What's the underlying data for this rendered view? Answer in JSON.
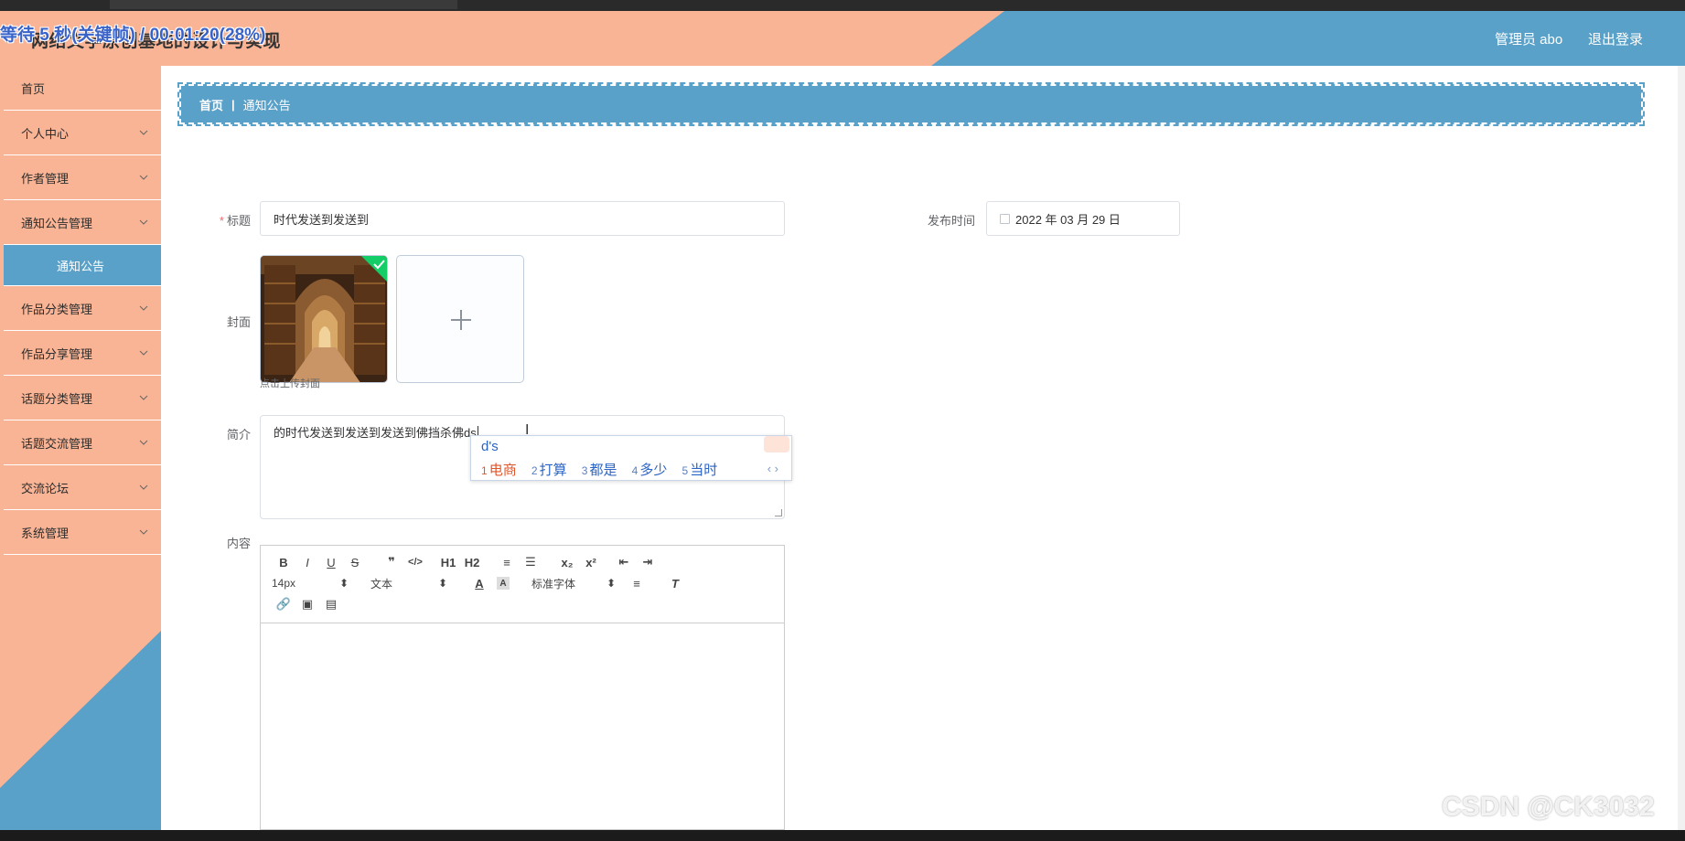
{
  "overlay_caption": "等待 5 秒(关键帧) / 00:01:20(28%)",
  "header": {
    "title": "网络文学原创基地的设计与实现",
    "admin_label": "管理员 abo",
    "logout_label": "退出登录"
  },
  "sidebar": {
    "items": [
      {
        "label": "首页",
        "chevron": false
      },
      {
        "label": "个人中心",
        "chevron": true
      },
      {
        "label": "作者管理",
        "chevron": true
      },
      {
        "label": "通知公告管理",
        "chevron": true
      },
      {
        "label": "作品分类管理",
        "chevron": true
      },
      {
        "label": "作品分享管理",
        "chevron": true
      },
      {
        "label": "话题分类管理",
        "chevron": true
      },
      {
        "label": "话题交流管理",
        "chevron": true
      },
      {
        "label": "交流论坛",
        "chevron": true
      },
      {
        "label": "系统管理",
        "chevron": true
      }
    ],
    "active_sub": "通知公告"
  },
  "breadcrumb": {
    "home": "首页",
    "separator": "|",
    "current": "通知公告"
  },
  "form": {
    "title_label": "标题",
    "title_value": "时代发送到发送到",
    "publish_time_label": "发布时间",
    "publish_time_value": "2022 年 03 月 29 日",
    "cover_label": "封面",
    "cover_hint": "点击上传封面",
    "intro_label": "简介",
    "intro_value": "的时代发送到发送到发送到佛挡杀佛ds",
    "content_label": "内容"
  },
  "ime": {
    "composition": "d's",
    "candidates": [
      {
        "num": "1",
        "text": "电商"
      },
      {
        "num": "2",
        "text": "打算"
      },
      {
        "num": "3",
        "text": "都是"
      },
      {
        "num": "4",
        "text": "多少"
      },
      {
        "num": "5",
        "text": "当时"
      }
    ],
    "nav": "‹ ›"
  },
  "editor": {
    "size_value": "14px",
    "block_value": "文本",
    "font_value": "标准字体",
    "buttons_row1": [
      "B",
      "I",
      "U",
      "S",
      "❞",
      "</>",
      "H1",
      "H2",
      "≡",
      "☰",
      "x₂",
      "x²",
      "⇤",
      "⇥"
    ],
    "icons": [
      "bold-icon",
      "italic-icon",
      "underline-icon",
      "strike-icon",
      "quote-icon",
      "code-icon",
      "h1-icon",
      "h2-icon",
      "ordered-list-icon",
      "bullet-list-icon",
      "subscript-icon",
      "superscript-icon",
      "outdent-icon",
      "indent-icon"
    ]
  },
  "watermark": "CSDN @CK3032",
  "colors": {
    "salmon": "#f9b495",
    "blue": "#5aa1c9",
    "required": "#f56c6c"
  }
}
